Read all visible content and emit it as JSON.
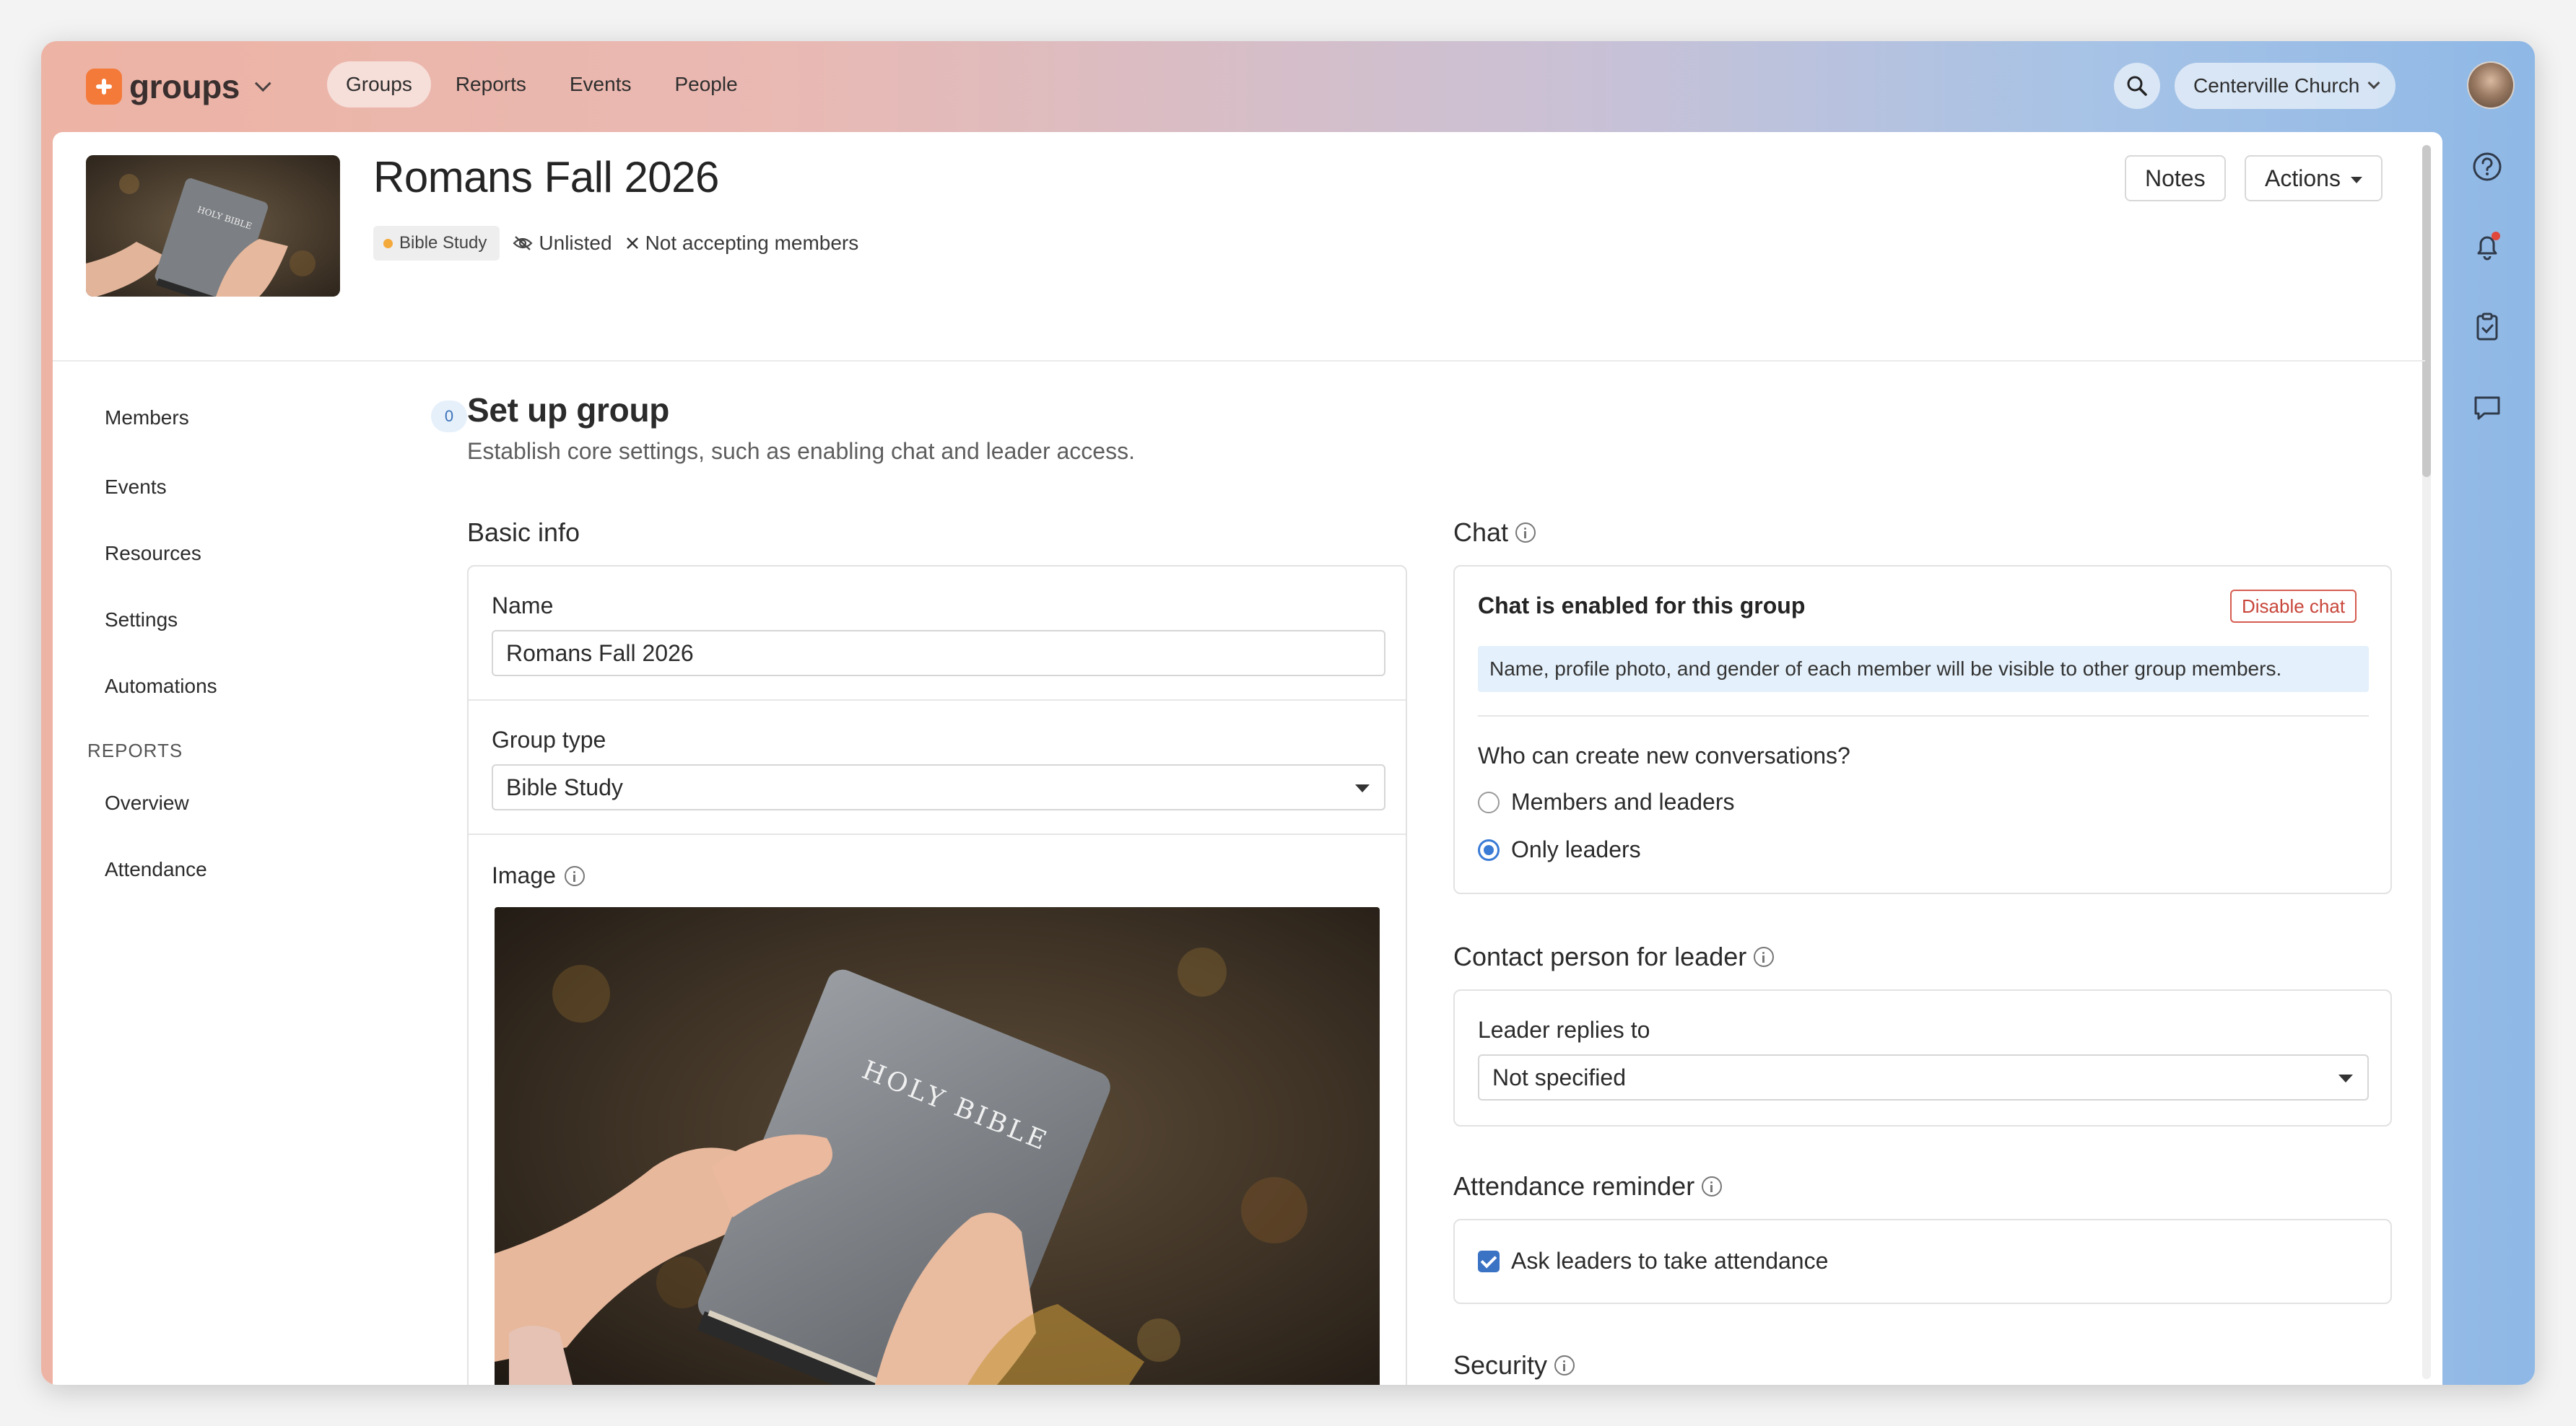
{
  "app": {
    "logo_text": "groups"
  },
  "nav": {
    "tabs": [
      "Groups",
      "Reports",
      "Events",
      "People"
    ],
    "active": "Groups"
  },
  "org": {
    "name": "Centerville Church"
  },
  "header": {
    "title": "Romans Fall 2026",
    "type_badge": "Bible Study",
    "visibility": "Unlisted",
    "membership": "Not accepting members",
    "notes_label": "Notes",
    "actions_label": "Actions"
  },
  "sidebar": {
    "items": [
      {
        "label": "Members",
        "count": "0"
      },
      {
        "label": "Events"
      },
      {
        "label": "Resources"
      },
      {
        "label": "Settings"
      },
      {
        "label": "Automations"
      }
    ],
    "reports_heading": "REPORTS",
    "report_items": [
      "Overview",
      "Attendance"
    ]
  },
  "setup": {
    "title": "Set up group",
    "subtitle": "Establish core settings, such as enabling chat and leader access."
  },
  "basic_info": {
    "heading": "Basic info",
    "name_label": "Name",
    "name_value": "Romans Fall 2026",
    "group_type_label": "Group type",
    "group_type_value": "Bible Study",
    "image_label": "Image",
    "image_text": "HOLY BIBLE"
  },
  "chat": {
    "heading": "Chat",
    "status": "Chat is enabled for this group",
    "disable_label": "Disable chat",
    "notice": "Name, profile photo, and gender of each member will be visible to other group members.",
    "question": "Who can create new conversations?",
    "options": [
      "Members and leaders",
      "Only leaders"
    ],
    "selected": "Only leaders"
  },
  "contact": {
    "heading": "Contact person for leader",
    "label": "Leader replies to",
    "value": "Not specified"
  },
  "attendance": {
    "heading": "Attendance reminder",
    "checkbox_label": "Ask leaders to take attendance",
    "checked": true
  },
  "security": {
    "heading": "Security"
  },
  "colors": {
    "accent": "#3a7bd5",
    "danger": "#c8463a",
    "brand": "#f47a3a"
  }
}
